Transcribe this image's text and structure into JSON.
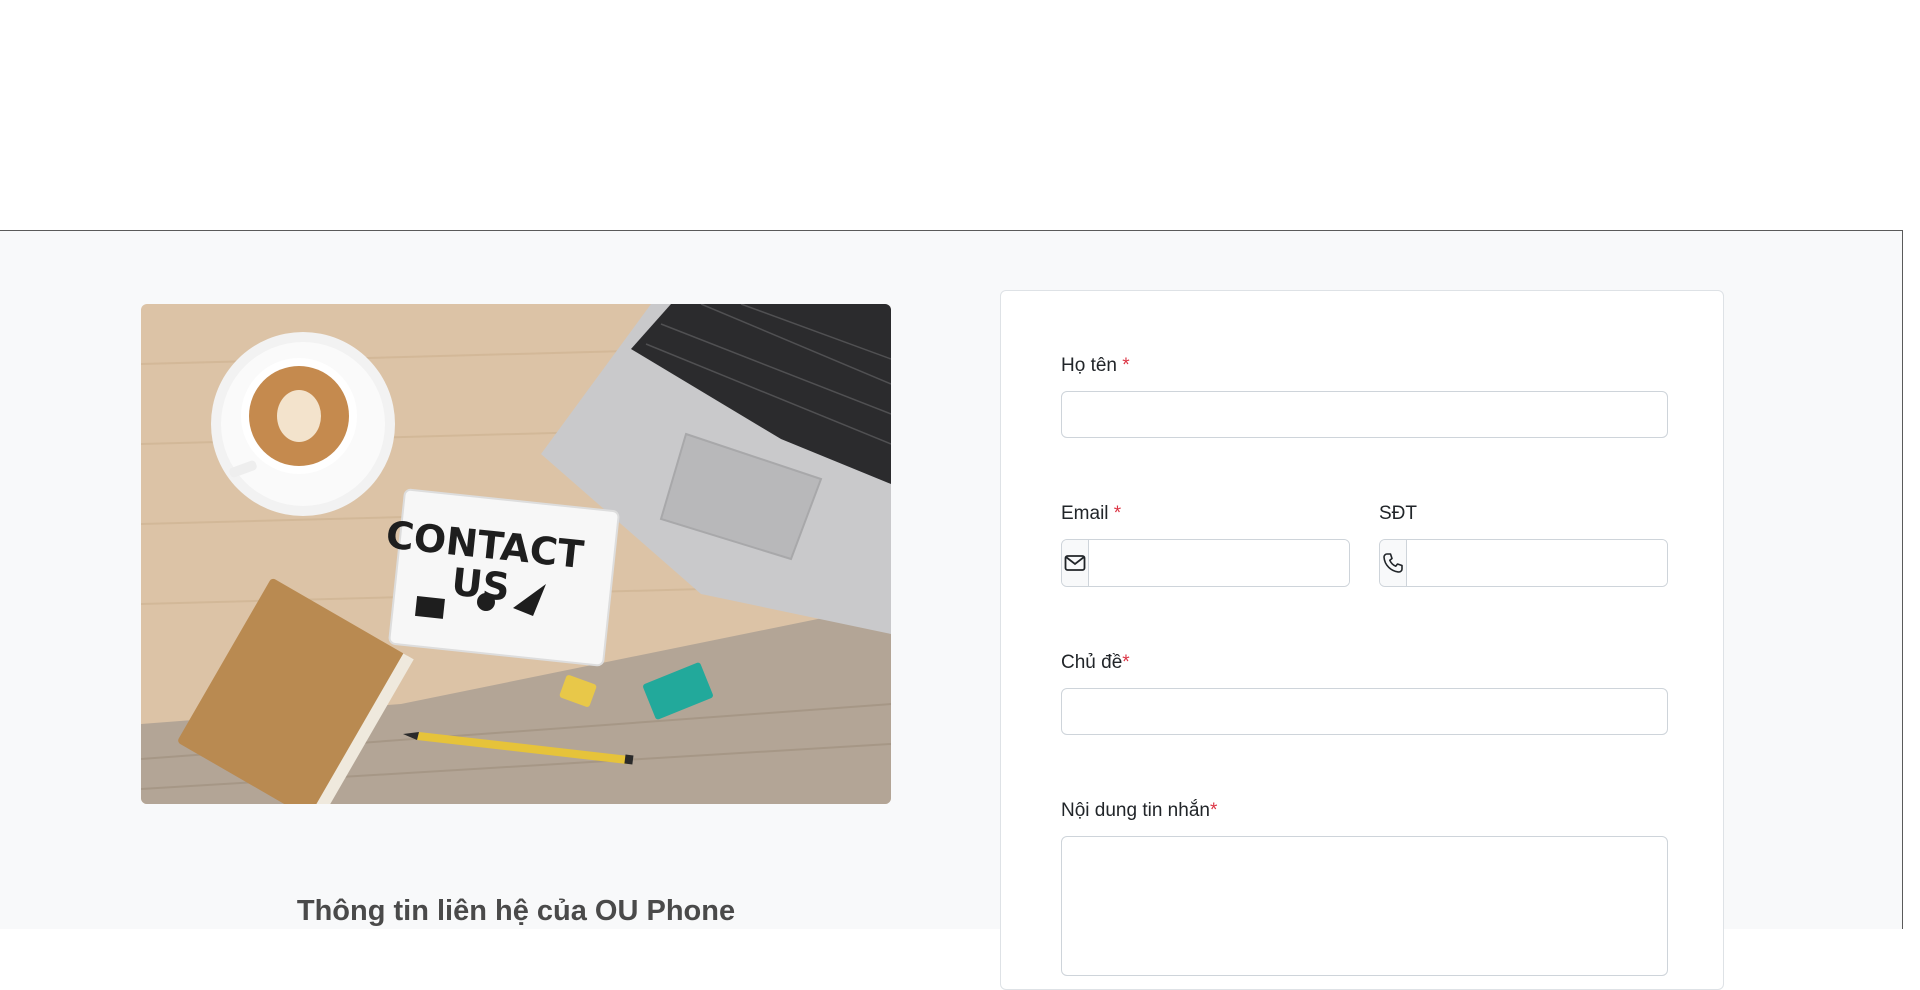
{
  "info": {
    "title": "Thông tin liên hệ của OU Phone"
  },
  "photo": {
    "sign_line1": "CONTACT",
    "sign_line2": "US"
  },
  "form": {
    "name_label": "Họ tên",
    "email_label": "Email",
    "phone_label": "SĐT",
    "subject_label": "Chủ đề",
    "message_label": "Nội dung tin nhắn",
    "required_mark": "*",
    "name_value": "",
    "email_value": "",
    "phone_value": "",
    "subject_value": "",
    "message_value": "",
    "email_icon": "envelope-icon",
    "phone_icon": "telephone-icon"
  },
  "colors": {
    "required": "#dc3545",
    "section_bg": "#f8f9fa",
    "border": "#ced4da"
  }
}
